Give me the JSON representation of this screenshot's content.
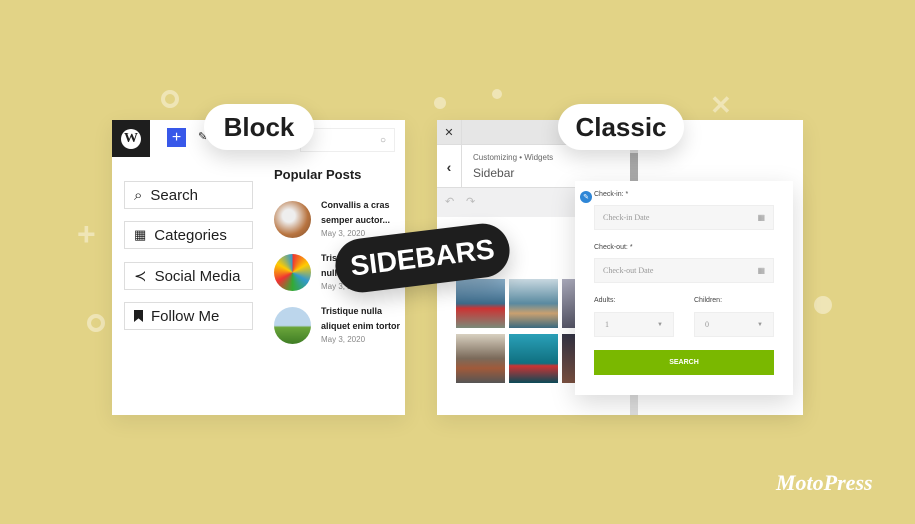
{
  "badges": {
    "block": "Block",
    "classic": "Classic",
    "sidebars": "SIDEBARS"
  },
  "brand": "MotoPress",
  "block_panel": {
    "widgets": [
      {
        "label": "Search",
        "icon": "search-icon"
      },
      {
        "label": "Categories",
        "icon": "grid-icon"
      },
      {
        "label": "Social Media",
        "icon": "share-icon"
      },
      {
        "label": "Follow Me",
        "icon": "bookmark-icon"
      }
    ],
    "popular_title": "Popular Posts",
    "posts": [
      {
        "title": "Convallis a cras semper auctor...",
        "date": "May 3, 2020"
      },
      {
        "title": "Tristique nulla aliquet",
        "date": "May 3, 2020"
      },
      {
        "title": "Tristique nulla aliquet enim tortor",
        "date": "May 3, 2020"
      }
    ]
  },
  "classic_panel": {
    "breadcrumb": "Customizing • Widgets",
    "section": "Sidebar",
    "form": {
      "checkin_label": "Check-in:",
      "checkin_placeholder": "Check-in Date",
      "checkout_label": "Check-out:",
      "checkout_placeholder": "Check-out Date",
      "required": "*",
      "adults_label": "Adults:",
      "adults_value": "1",
      "children_label": "Children:",
      "children_value": "0",
      "search_label": "SEARCH"
    }
  },
  "colors": {
    "background": "#e2d386",
    "accent_blue": "#3858e9",
    "search_green": "#7ab800",
    "dark": "#1e1e1e"
  }
}
